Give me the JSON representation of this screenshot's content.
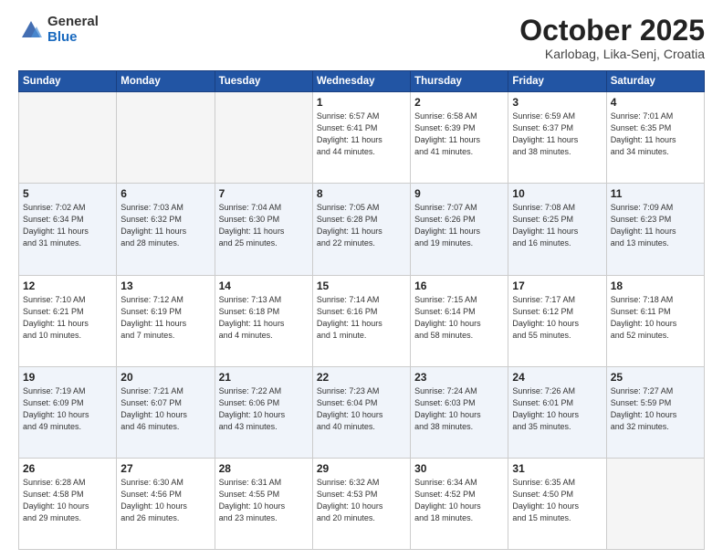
{
  "header": {
    "logo_general": "General",
    "logo_blue": "Blue",
    "month": "October 2025",
    "location": "Karlobag, Lika-Senj, Croatia"
  },
  "weekdays": [
    "Sunday",
    "Monday",
    "Tuesday",
    "Wednesday",
    "Thursday",
    "Friday",
    "Saturday"
  ],
  "weeks": [
    [
      {
        "day": "",
        "info": ""
      },
      {
        "day": "",
        "info": ""
      },
      {
        "day": "",
        "info": ""
      },
      {
        "day": "1",
        "info": "Sunrise: 6:57 AM\nSunset: 6:41 PM\nDaylight: 11 hours\nand 44 minutes."
      },
      {
        "day": "2",
        "info": "Sunrise: 6:58 AM\nSunset: 6:39 PM\nDaylight: 11 hours\nand 41 minutes."
      },
      {
        "day": "3",
        "info": "Sunrise: 6:59 AM\nSunset: 6:37 PM\nDaylight: 11 hours\nand 38 minutes."
      },
      {
        "day": "4",
        "info": "Sunrise: 7:01 AM\nSunset: 6:35 PM\nDaylight: 11 hours\nand 34 minutes."
      }
    ],
    [
      {
        "day": "5",
        "info": "Sunrise: 7:02 AM\nSunset: 6:34 PM\nDaylight: 11 hours\nand 31 minutes."
      },
      {
        "day": "6",
        "info": "Sunrise: 7:03 AM\nSunset: 6:32 PM\nDaylight: 11 hours\nand 28 minutes."
      },
      {
        "day": "7",
        "info": "Sunrise: 7:04 AM\nSunset: 6:30 PM\nDaylight: 11 hours\nand 25 minutes."
      },
      {
        "day": "8",
        "info": "Sunrise: 7:05 AM\nSunset: 6:28 PM\nDaylight: 11 hours\nand 22 minutes."
      },
      {
        "day": "9",
        "info": "Sunrise: 7:07 AM\nSunset: 6:26 PM\nDaylight: 11 hours\nand 19 minutes."
      },
      {
        "day": "10",
        "info": "Sunrise: 7:08 AM\nSunset: 6:25 PM\nDaylight: 11 hours\nand 16 minutes."
      },
      {
        "day": "11",
        "info": "Sunrise: 7:09 AM\nSunset: 6:23 PM\nDaylight: 11 hours\nand 13 minutes."
      }
    ],
    [
      {
        "day": "12",
        "info": "Sunrise: 7:10 AM\nSunset: 6:21 PM\nDaylight: 11 hours\nand 10 minutes."
      },
      {
        "day": "13",
        "info": "Sunrise: 7:12 AM\nSunset: 6:19 PM\nDaylight: 11 hours\nand 7 minutes."
      },
      {
        "day": "14",
        "info": "Sunrise: 7:13 AM\nSunset: 6:18 PM\nDaylight: 11 hours\nand 4 minutes."
      },
      {
        "day": "15",
        "info": "Sunrise: 7:14 AM\nSunset: 6:16 PM\nDaylight: 11 hours\nand 1 minute."
      },
      {
        "day": "16",
        "info": "Sunrise: 7:15 AM\nSunset: 6:14 PM\nDaylight: 10 hours\nand 58 minutes."
      },
      {
        "day": "17",
        "info": "Sunrise: 7:17 AM\nSunset: 6:12 PM\nDaylight: 10 hours\nand 55 minutes."
      },
      {
        "day": "18",
        "info": "Sunrise: 7:18 AM\nSunset: 6:11 PM\nDaylight: 10 hours\nand 52 minutes."
      }
    ],
    [
      {
        "day": "19",
        "info": "Sunrise: 7:19 AM\nSunset: 6:09 PM\nDaylight: 10 hours\nand 49 minutes."
      },
      {
        "day": "20",
        "info": "Sunrise: 7:21 AM\nSunset: 6:07 PM\nDaylight: 10 hours\nand 46 minutes."
      },
      {
        "day": "21",
        "info": "Sunrise: 7:22 AM\nSunset: 6:06 PM\nDaylight: 10 hours\nand 43 minutes."
      },
      {
        "day": "22",
        "info": "Sunrise: 7:23 AM\nSunset: 6:04 PM\nDaylight: 10 hours\nand 40 minutes."
      },
      {
        "day": "23",
        "info": "Sunrise: 7:24 AM\nSunset: 6:03 PM\nDaylight: 10 hours\nand 38 minutes."
      },
      {
        "day": "24",
        "info": "Sunrise: 7:26 AM\nSunset: 6:01 PM\nDaylight: 10 hours\nand 35 minutes."
      },
      {
        "day": "25",
        "info": "Sunrise: 7:27 AM\nSunset: 5:59 PM\nDaylight: 10 hours\nand 32 minutes."
      }
    ],
    [
      {
        "day": "26",
        "info": "Sunrise: 6:28 AM\nSunset: 4:58 PM\nDaylight: 10 hours\nand 29 minutes."
      },
      {
        "day": "27",
        "info": "Sunrise: 6:30 AM\nSunset: 4:56 PM\nDaylight: 10 hours\nand 26 minutes."
      },
      {
        "day": "28",
        "info": "Sunrise: 6:31 AM\nSunset: 4:55 PM\nDaylight: 10 hours\nand 23 minutes."
      },
      {
        "day": "29",
        "info": "Sunrise: 6:32 AM\nSunset: 4:53 PM\nDaylight: 10 hours\nand 20 minutes."
      },
      {
        "day": "30",
        "info": "Sunrise: 6:34 AM\nSunset: 4:52 PM\nDaylight: 10 hours\nand 18 minutes."
      },
      {
        "day": "31",
        "info": "Sunrise: 6:35 AM\nSunset: 4:50 PM\nDaylight: 10 hours\nand 15 minutes."
      },
      {
        "day": "",
        "info": ""
      }
    ]
  ]
}
